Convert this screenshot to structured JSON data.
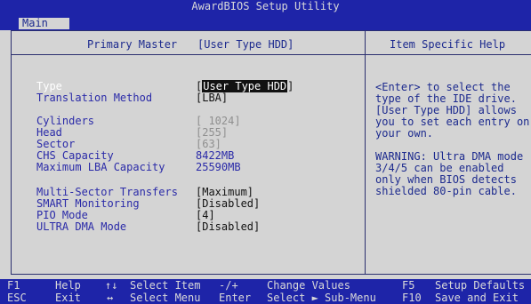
{
  "header": {
    "title": "AwardBIOS Setup Utility"
  },
  "tabs": [
    {
      "label": "Main"
    }
  ],
  "panel": {
    "title_left": "Primary Master",
    "title_right": "[User Type HDD]",
    "help_title": "Item Specific Help"
  },
  "settings": {
    "type": {
      "label": "Type",
      "value_open": "[",
      "value_inner": "User Type HDD",
      "value_close": "]"
    },
    "translation": {
      "label": "Translation Method",
      "value": "[LBA]"
    },
    "cylinders": {
      "label": "Cylinders",
      "value": "[ 1024]"
    },
    "head": {
      "label": "Head",
      "value": "[255]"
    },
    "sector": {
      "label": "Sector",
      "value": "[63]"
    },
    "chs": {
      "label": "CHS Capacity",
      "value": "8422MB"
    },
    "lba": {
      "label": "Maximum LBA Capacity",
      "value": "25590MB"
    },
    "multisector": {
      "label": "Multi-Sector Transfers",
      "value": "[Maximum]"
    },
    "smart": {
      "label": "SMART Monitoring",
      "value": "[Disabled]"
    },
    "pio": {
      "label": "PIO Mode",
      "value": "[4]"
    },
    "udma": {
      "label": "ULTRA DMA Mode",
      "value": "[Disabled]"
    }
  },
  "help": {
    "para1_lines": [
      "<Enter> to select the",
      "type of the IDE drive.",
      "[User Type HDD] allows",
      "you to set each entry on",
      "your own."
    ],
    "para2_lines": [
      "WARNING: Ultra DMA mode",
      "3/4/5 can be enabled",
      "only when BIOS detects",
      "shielded 80-pin cable."
    ]
  },
  "statusbar": {
    "f1_key": "F1",
    "f1_label": "Help",
    "updown_key": "↑↓",
    "updown_label": "Select Item",
    "minusplus_key": "-/+",
    "minusplus_label": "Change Values",
    "f5_key": "F5",
    "f5_label": "Setup Defaults",
    "esc_key": "ESC",
    "esc_label": "Exit",
    "leftright_key": "↔",
    "leftright_label": "Select Menu",
    "enter_key": "Enter",
    "enter_label": "Select ► Sub-Menu",
    "f10_key": "F10",
    "f10_label": "Save and Exit"
  }
}
